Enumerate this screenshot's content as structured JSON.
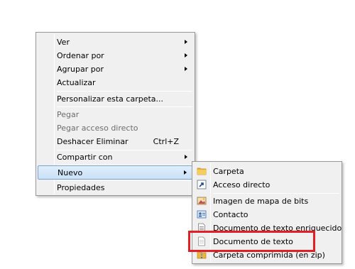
{
  "context_menu": {
    "items": [
      {
        "label": "Ver",
        "has_submenu": true
      },
      {
        "label": "Ordenar por",
        "has_submenu": true
      },
      {
        "label": "Agrupar por",
        "has_submenu": true
      },
      {
        "label": "Actualizar"
      },
      {
        "label": "Personalizar esta carpeta..."
      },
      {
        "label": "Pegar",
        "disabled": true
      },
      {
        "label": "Pegar acceso directo",
        "disabled": true
      },
      {
        "label": "Deshacer Eliminar",
        "shortcut": "Ctrl+Z"
      },
      {
        "label": "Compartir con",
        "has_submenu": true
      },
      {
        "label": "Nuevo",
        "has_submenu": true,
        "highlighted": true
      },
      {
        "label": "Propiedades"
      }
    ]
  },
  "new_submenu": {
    "items": [
      {
        "label": "Carpeta",
        "icon": "folder-icon"
      },
      {
        "label": "Acceso directo",
        "icon": "shortcut-icon"
      },
      {
        "label": "Imagen de mapa de bits",
        "icon": "bitmap-image-icon"
      },
      {
        "label": "Contacto",
        "icon": "contact-icon"
      },
      {
        "label": "Documento de texto enriquecido",
        "icon": "rich-text-document-icon"
      },
      {
        "label": "Documento de texto",
        "icon": "text-document-icon",
        "emphasized": true
      },
      {
        "label": "Carpeta comprimida (en zip)",
        "icon": "zip-folder-icon"
      }
    ]
  },
  "colors": {
    "menu_background": "#f0f0f0",
    "highlight_border": "#7da2ce",
    "annotation_red": "#e31e24"
  }
}
